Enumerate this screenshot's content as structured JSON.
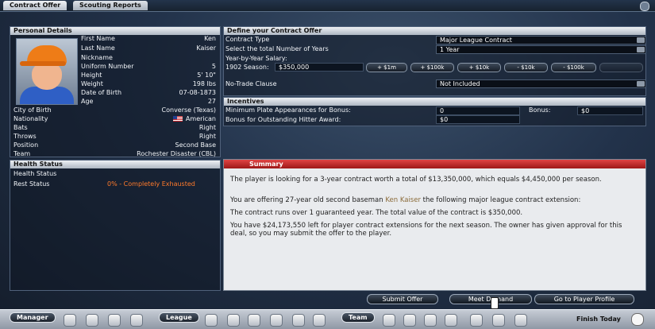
{
  "tabs": {
    "active": "Contract Offer",
    "inactive": "Scouting Reports"
  },
  "personal": {
    "header": "Personal Details",
    "rows": [
      {
        "label": "First Name",
        "value": "Ken"
      },
      {
        "label": "Last Name",
        "value": "Kaiser"
      },
      {
        "label": "Nickname",
        "value": ""
      },
      {
        "label": "Uniform Number",
        "value": "5"
      },
      {
        "label": "Height",
        "value": "5' 10\""
      },
      {
        "label": "Weight",
        "value": "198 lbs"
      },
      {
        "label": "Date of Birth",
        "value": "07-08-1873"
      },
      {
        "label": "Age",
        "value": "27"
      }
    ],
    "lower": [
      {
        "label": "City of Birth",
        "value": "Converse (Texas)"
      },
      {
        "label": "Nationality",
        "value": "American"
      },
      {
        "label": "Bats",
        "value": "Right"
      },
      {
        "label": "Throws",
        "value": "Right"
      },
      {
        "label": "Position",
        "value": "Second Base"
      },
      {
        "label": "Team",
        "value": "Rochester Disaster (CBL)"
      }
    ]
  },
  "health": {
    "header": "Health Status",
    "label": "Health Status",
    "rest_label": "Rest Status",
    "rest_value": "0% - Completely Exhausted"
  },
  "contract": {
    "header": "Define your Contract Offer",
    "type_label": "Contract Type",
    "type_value": "Major League Contract",
    "years_label": "Select the total Number of Years",
    "years_value": "1 Year",
    "salary_label": "Year-by-Year Salary:",
    "season_label": "1902 Season:",
    "season_value": "$350,000",
    "buttons": [
      "+ $1m",
      "+ $100k",
      "+ $10k",
      "- $10k",
      "- $100k",
      ""
    ],
    "ntc_label": "No-Trade Clause",
    "ntc_value": "Not Included"
  },
  "incentives": {
    "header": "Incentives",
    "pa_label": "Minimum Plate Appearances for Bonus:",
    "pa_value": "0",
    "bonus_label": "Bonus:",
    "bonus_value": "$0",
    "award_label": "Bonus for Outstanding Hitter Award:",
    "award_value": "$0"
  },
  "summary": {
    "header": "Summary",
    "p1": "The player is looking for a 3-year contract worth a total of $13,350,000, which equals $4,450,000 per season.",
    "p2a": "You are offering 27-year old second baseman ",
    "p2name": "Ken Kaiser",
    "p2b": " the following major league contract extension:",
    "p3": "The contract runs over 1 guaranteed year. The total value of the contract is $350,000.",
    "p4": "You have $24,173,550 left for player contract extensions for the next season. The owner has given approval for this deal, so you may submit the offer to the player."
  },
  "actions": {
    "submit": "Submit Offer",
    "meet": "Meet Demand",
    "profile": "Go to Player Profile"
  },
  "taskbar": {
    "manager": "Manager",
    "league": "League",
    "team": "Team",
    "finish": "Finish Today"
  }
}
